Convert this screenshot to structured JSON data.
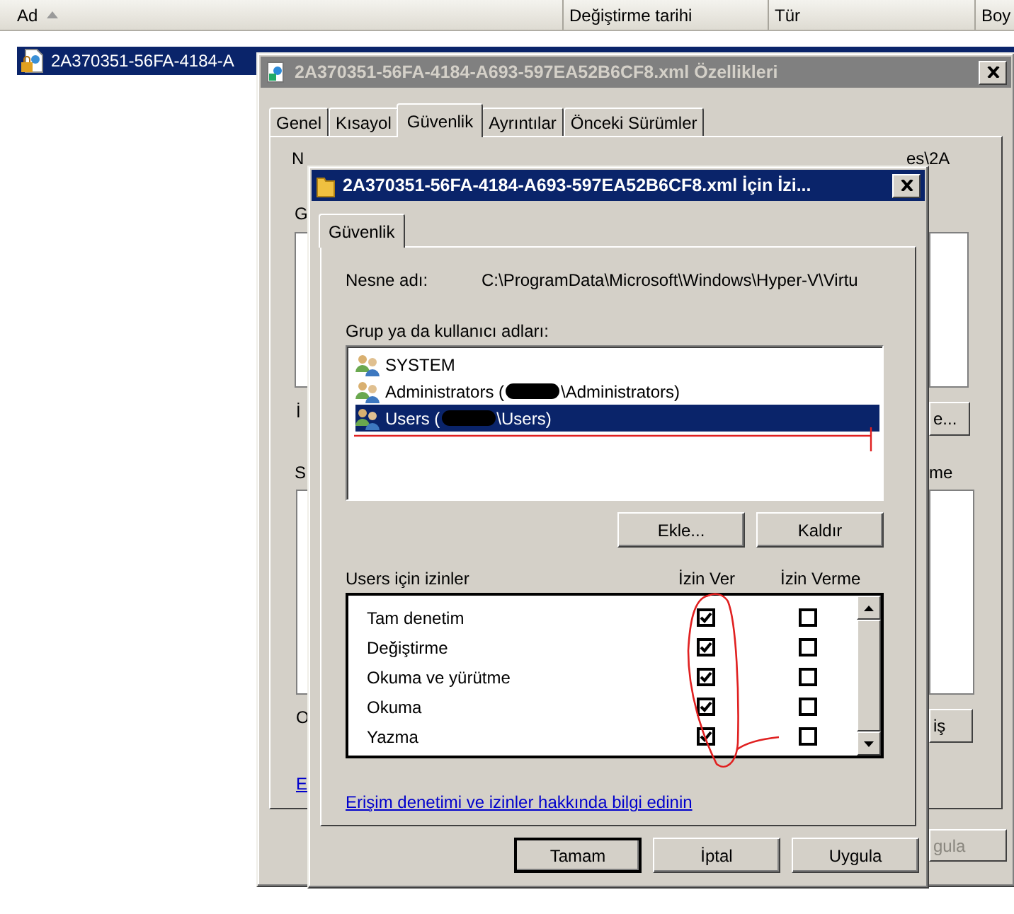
{
  "explorer": {
    "columns": [
      {
        "label": "Ad",
        "sorted": true
      },
      {
        "label": "Değiştirme tarihi",
        "sorted": false
      },
      {
        "label": "Tür",
        "sorted": false
      },
      {
        "label": "Boy",
        "sorted": false
      }
    ],
    "files": [
      {
        "name": "2A370351-56FA-4184-A",
        "selected": true
      }
    ]
  },
  "properties_dialog": {
    "title": "2A370351-56FA-4184-A693-597EA52B6CF8.xml Özellikleri",
    "active": false,
    "tabs": [
      {
        "label": "Genel",
        "selected": false
      },
      {
        "label": "Kısayol",
        "selected": false
      },
      {
        "label": "Güvenlik",
        "selected": true
      },
      {
        "label": "Ayrıntılar",
        "selected": false
      },
      {
        "label": "Önceki Sürümler",
        "selected": false
      }
    ],
    "fragments": [
      {
        "kind": "text",
        "text": "N"
      },
      {
        "kind": "text",
        "text": "es\\2A"
      },
      {
        "kind": "text",
        "text": "G"
      },
      {
        "kind": "text",
        "text": "İ"
      },
      {
        "kind": "button",
        "text": "e...",
        "disabled": false
      },
      {
        "kind": "text",
        "text": "S"
      },
      {
        "kind": "text",
        "text": "me"
      },
      {
        "kind": "text",
        "text": "O"
      },
      {
        "kind": "button",
        "text": "iş",
        "disabled": false
      },
      {
        "kind": "link",
        "text": "E"
      },
      {
        "kind": "button",
        "text": "gula",
        "disabled": true
      }
    ]
  },
  "permissions_dialog": {
    "title": "2A370351-56FA-4184-A693-597EA52B6CF8.xml İçin İzi...",
    "active": true,
    "tabs": [
      {
        "label": "Güvenlik",
        "selected": true
      }
    ],
    "object_label": "Nesne adı:",
    "object_path": "C:\\ProgramData\\Microsoft\\Windows\\Hyper-V\\Virtu",
    "principals_label": "Grup ya da kullanıcı adları:",
    "principals": [
      {
        "name_start": "SYSTEM",
        "redacted": false,
        "selected": false
      },
      {
        "name_start": "Administrators (",
        "redacted": true,
        "name_end": "\\Administrators)",
        "selected": false
      },
      {
        "name_start": "Users (",
        "redacted": true,
        "name_end": "\\Users)",
        "selected": true
      }
    ],
    "list_buttons": [
      "Ekle...",
      "Kaldır"
    ],
    "permissions_label": "Users için izinler",
    "allow_header": "İzin Ver",
    "deny_header": "İzin Verme",
    "permissions": [
      {
        "name": "Tam denetim",
        "allow": true,
        "deny": false
      },
      {
        "name": "Değiştirme",
        "allow": true,
        "deny": false
      },
      {
        "name": "Okuma ve yürütme",
        "allow": true,
        "deny": false
      },
      {
        "name": "Okuma",
        "allow": true,
        "deny": false
      },
      {
        "name": "Yazma",
        "allow": true,
        "deny": false
      }
    ],
    "help_link": "Erişim denetimi ve izinler hakkında bilgi edinin",
    "buttons": [
      {
        "label": "Tamam",
        "default": true
      },
      {
        "label": "İptal",
        "default": false
      },
      {
        "label": "Uygula",
        "default": false
      }
    ]
  }
}
